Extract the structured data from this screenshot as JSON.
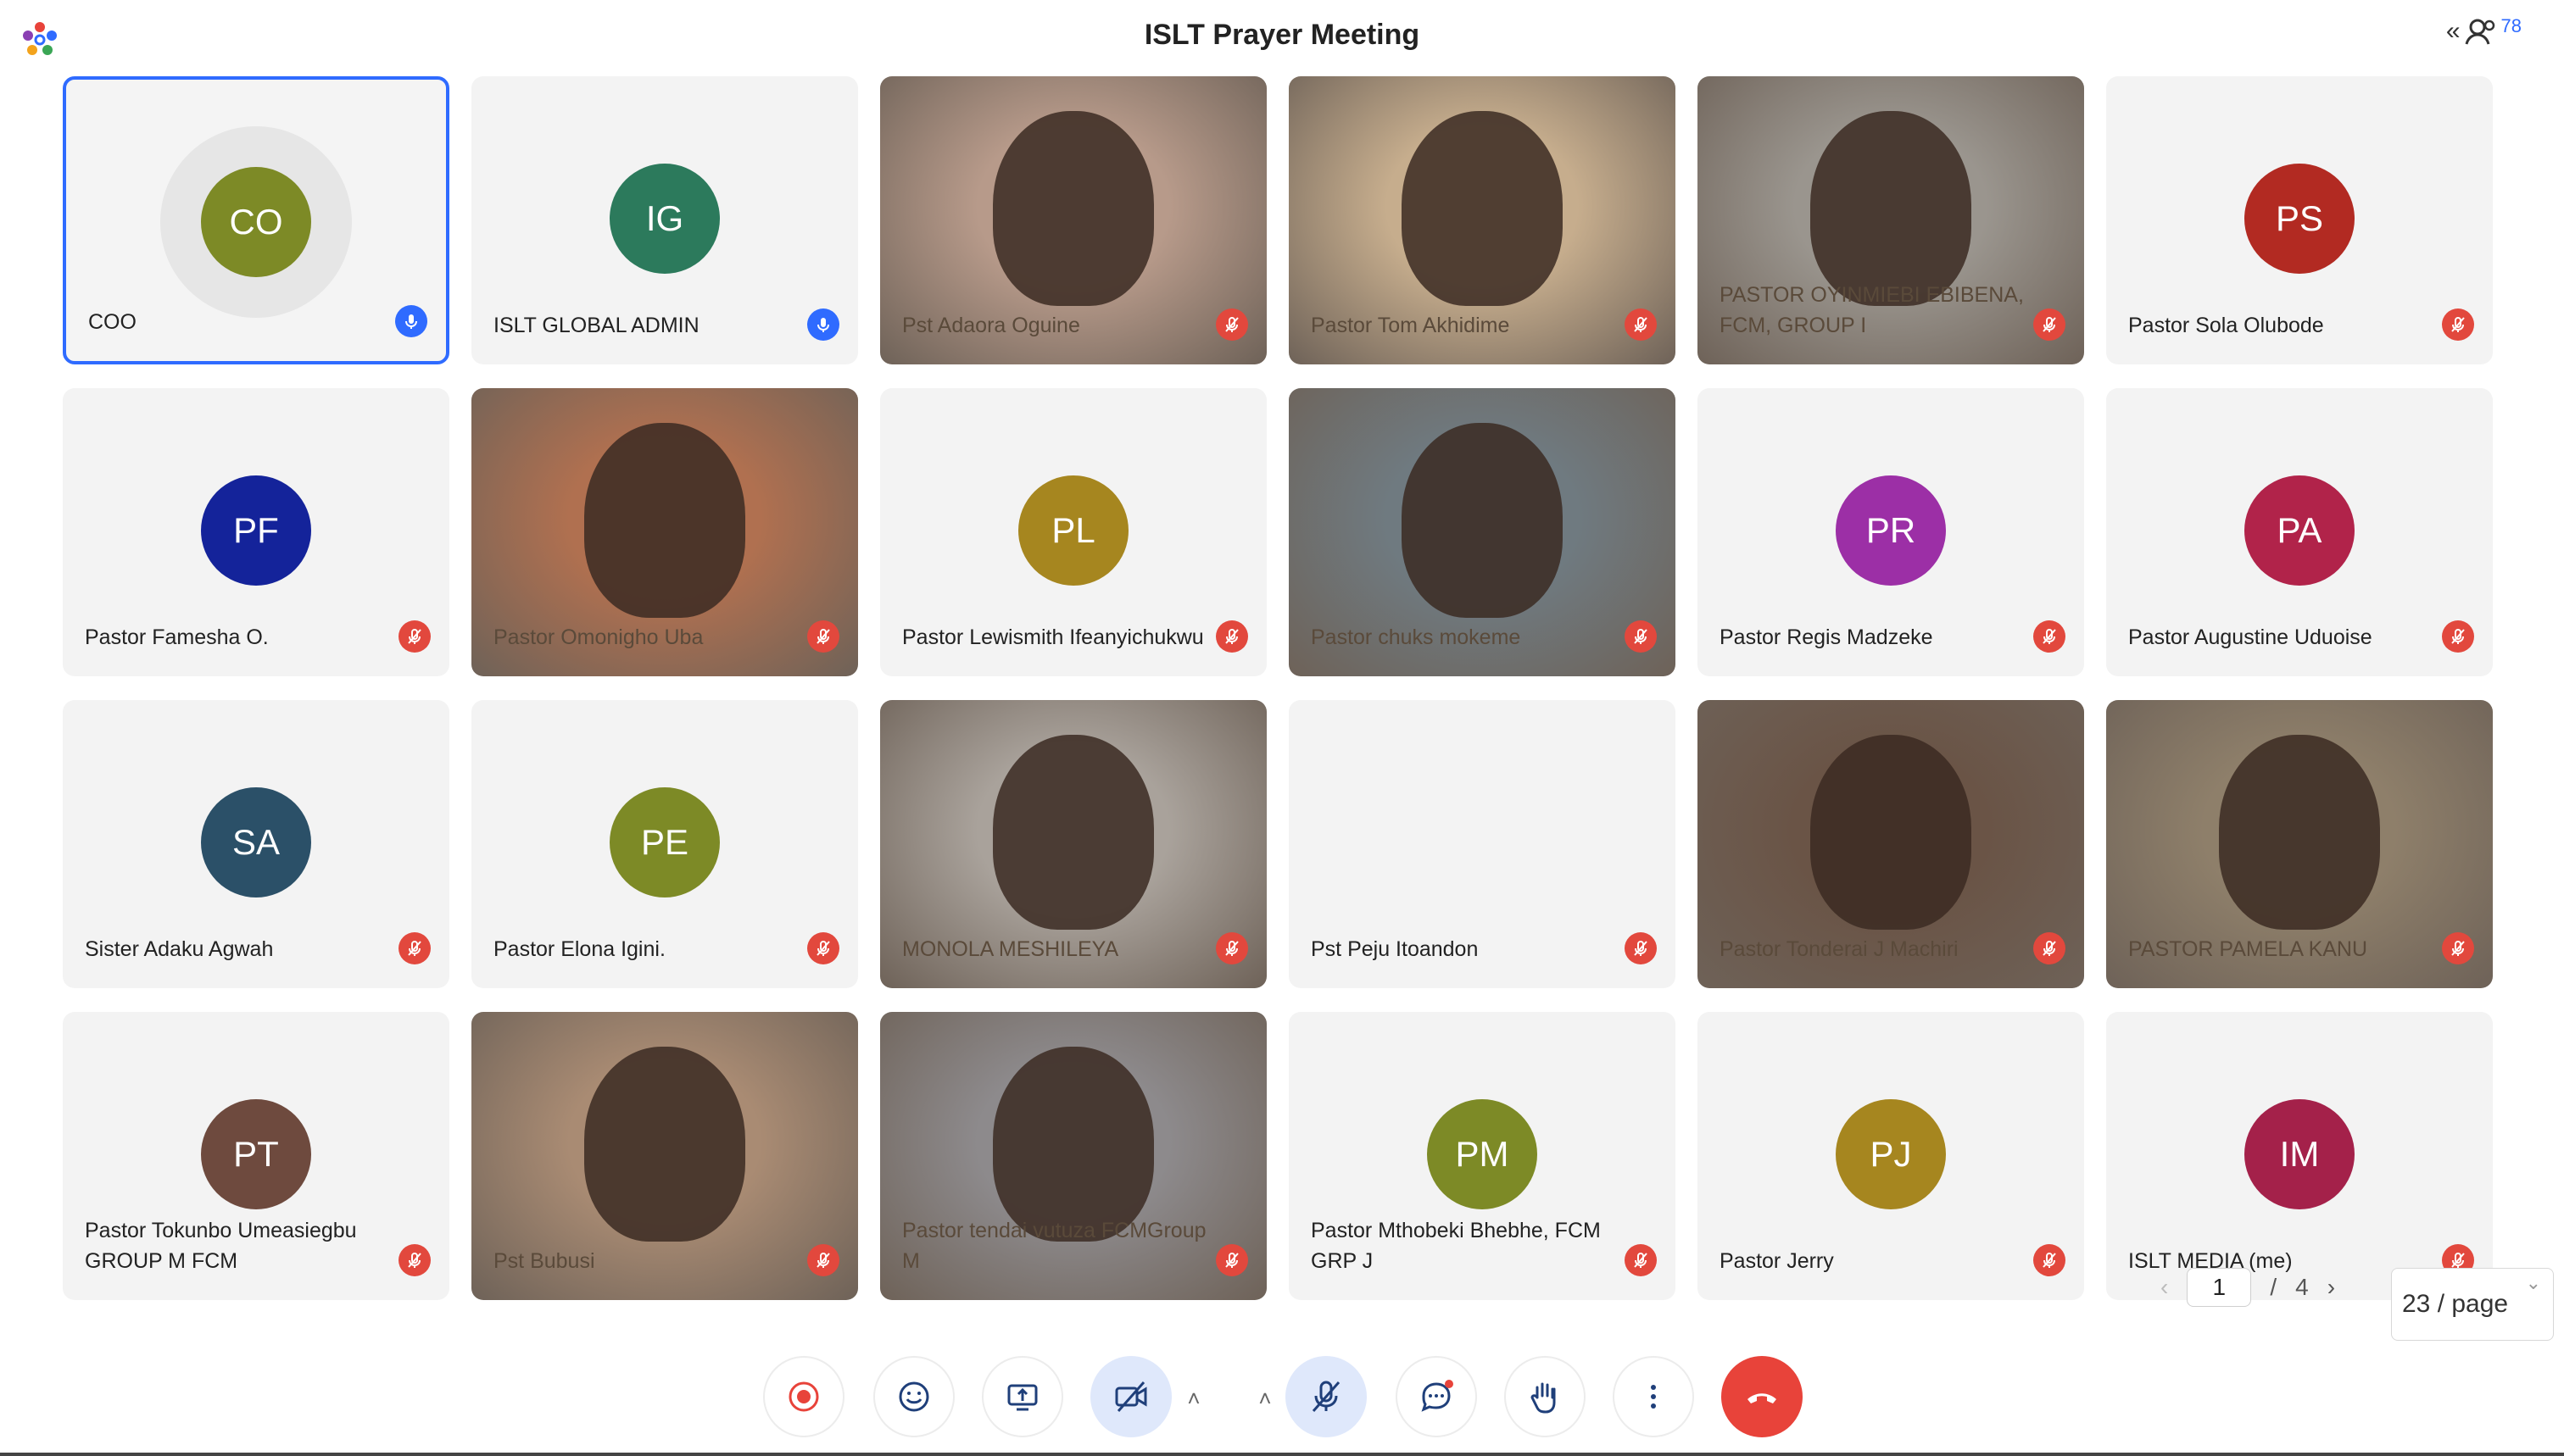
{
  "meeting": {
    "title": "ISLT Prayer Meeting",
    "participant_count": "78"
  },
  "tiles": [
    {
      "name": "COO",
      "initials": "CO",
      "color": "#7d8a26",
      "mic": "on",
      "active": true
    },
    {
      "name": "ISLT GLOBAL ADMIN",
      "initials": "IG",
      "color": "#2c7a5c",
      "mic": "on"
    },
    {
      "name": "Pst Adaora Oguine",
      "video": true,
      "mic": "muted",
      "bg": "#b79a8a"
    },
    {
      "name": "Pastor Tom Akhidime",
      "video": true,
      "mic": "muted",
      "bg": "#c6ad8d"
    },
    {
      "name": "PASTOR OYINMIEBI EBIBENA, FCM, GROUP I",
      "video": true,
      "mic": "muted",
      "bg": "#9a958e"
    },
    {
      "name": "Pastor Sola Olubode",
      "initials": "PS",
      "color": "#b22a22",
      "mic": "muted"
    },
    {
      "name": "Pastor Famesha O.",
      "initials": "PF",
      "color": "#14239a",
      "mic": "muted"
    },
    {
      "name": "Pastor Omonigho Uba",
      "video": true,
      "mic": "muted",
      "bg": "#b07050"
    },
    {
      "name": "Pastor Lewismith Ifeanyichukwu",
      "initials": "PL",
      "color": "#a6861f",
      "mic": "muted"
    },
    {
      "name": "Pastor chuks mokeme",
      "video": true,
      "mic": "muted",
      "bg": "#6f7a80"
    },
    {
      "name": "Pastor Regis Madzeke",
      "initials": "PR",
      "color": "#9c2fa6",
      "mic": "muted"
    },
    {
      "name": "Pastor Augustine Uduoise",
      "initials": "PA",
      "color": "#b1234a",
      "mic": "muted"
    },
    {
      "name": "Sister Adaku Agwah",
      "initials": "SA",
      "color": "#2b5068",
      "mic": "muted"
    },
    {
      "name": "Pastor Elona Igini.",
      "initials": "PE",
      "color": "#7d8a26",
      "mic": "muted"
    },
    {
      "name": "MONOLA MESHILEYA",
      "video": true,
      "mic": "muted",
      "bg": "#a9a29b"
    },
    {
      "name": "Pst Peju Itoandon",
      "mic": "muted",
      "blank": true
    },
    {
      "name": "Pastor Tonderai J Machiri",
      "video": true,
      "mic": "muted",
      "bg": "#6a5446"
    },
    {
      "name": "PASTOR PAMELA KANU",
      "video": true,
      "mic": "muted",
      "bg": "#8e7f6a"
    },
    {
      "name": "Pastor Tokunbo Umeasiegbu GROUP M FCM",
      "initials": "PT",
      "color": "#6e4a3e",
      "mic": "muted"
    },
    {
      "name": "Pst Bubusi",
      "video": true,
      "mic": "muted",
      "bg": "#a98b73"
    },
    {
      "name": "Pastor tendai vutuza FCMGroup M",
      "video": true,
      "mic": "muted",
      "bg": "#8d8a8c"
    },
    {
      "name": "Pastor Mthobeki Bhebhe, FCM GRP J",
      "initials": "PM",
      "color": "#7d8a26",
      "mic": "muted"
    },
    {
      "name": "Pastor Jerry",
      "initials": "PJ",
      "color": "#a6861f",
      "mic": "muted"
    },
    {
      "name": "ISLT MEDIA (me)",
      "initials": "IM",
      "color": "#a4214a",
      "mic": "muted"
    }
  ],
  "pagination": {
    "current": "1",
    "separator": "/",
    "total": "4",
    "per_page": "23 / page"
  },
  "toolbar": {
    "buttons": [
      "record-icon",
      "reactions-icon",
      "share-screen-icon",
      "camera-off-icon",
      "mic-muted-icon",
      "chat-icon",
      "raise-hand-icon",
      "more-icon",
      "end-call-icon"
    ]
  }
}
